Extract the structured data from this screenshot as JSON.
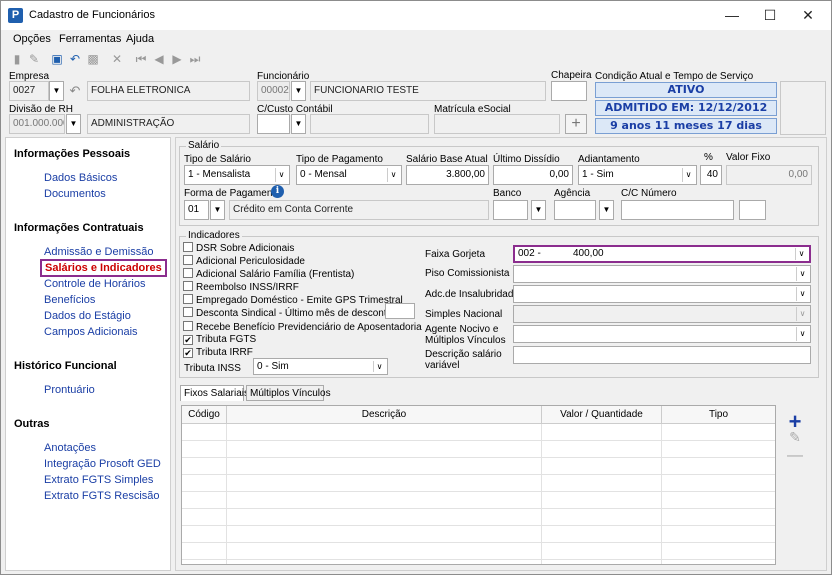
{
  "window": {
    "title": "Cadastro de Funcionários",
    "icon": "P"
  },
  "menu": [
    "Opções",
    "Ferramentas",
    "Ajuda"
  ],
  "header": {
    "empresa_label": "Empresa",
    "empresa_code": "0027",
    "empresa_name": "FOLHA ELETRONICA",
    "funcionario_label": "Funcionário",
    "funcionario_code": "00002",
    "funcionario_name": "FUNCIONARIO TESTE",
    "chapeira_label": "Chapeira",
    "chapeira_value": "",
    "divisao_label": "Divisão de RH",
    "divisao_code": "001.000.000",
    "divisao_name": "ADMINISTRAÇÃO",
    "custo_label": "C/Custo Contábil",
    "custo_value": "",
    "matricula_label": "Matrícula eSocial",
    "matricula_value": "",
    "condicao_label": "Condição Atual e Tempo de Serviço",
    "status": "ATIVO",
    "admitido": "ADMITIDO EM: 12/12/2012",
    "tempo": "9 anos 11 meses 17 dias"
  },
  "sidebar": {
    "sections": [
      {
        "title": "Informações Pessoais",
        "items": [
          "Dados Básicos",
          "Documentos"
        ]
      },
      {
        "title": "Informações Contratuais",
        "items": [
          "Admissão e Demissão",
          "Salários e Indicadores",
          "Controle de Horários",
          "Benefícios",
          "Dados do Estágio",
          "Campos Adicionais"
        ]
      },
      {
        "title": "Histórico Funcional",
        "items": [
          "Prontuário"
        ]
      },
      {
        "title": "Outras",
        "items": [
          "Anotações",
          "Integração Prosoft GED",
          "Extrato FGTS Simples",
          "Extrato FGTS Rescisão"
        ]
      }
    ],
    "active": "Salários e Indicadores"
  },
  "salario": {
    "group_title": "Salário",
    "tipo_salario_label": "Tipo de Salário",
    "tipo_salario": "1 - Mensalista",
    "tipo_pagamento_label": "Tipo de Pagamento",
    "tipo_pagamento": "0 - Mensal",
    "base_label": "Salário Base Atual",
    "base": "3.800,00",
    "ultimo_label": "Último Dissídio",
    "ultimo": "0,00",
    "adiantamento_label": "Adiantamento",
    "adiantamento": "1 - Sim",
    "pct_label": "%",
    "pct": "40",
    "fixo_label": "Valor Fixo",
    "fixo": "0,00",
    "forma_label": "Forma de Pagamento",
    "forma_code": "01",
    "forma_desc": "Crédito em Conta Corrente",
    "banco_label": "Banco",
    "banco": "",
    "agencia_label": "Agência",
    "agencia": "",
    "cc_label": "C/C Número",
    "cc": "",
    "cc_dv": ""
  },
  "indicadores": {
    "group_title": "Indicadores",
    "checks": [
      {
        "label": "DSR Sobre Adicionais",
        "checked": false
      },
      {
        "label": "Adicional Periculosidade",
        "checked": false
      },
      {
        "label": "Adicional Salário Família (Frentista)",
        "checked": false
      },
      {
        "label": "Reembolso INSS/IRRF",
        "checked": false
      },
      {
        "label": "Empregado Doméstico - Emite GPS Trimestral",
        "checked": false
      },
      {
        "label": "Desconta Sindical - Último mês de desconto",
        "checked": false
      },
      {
        "label": "Recebe Benefício Previdenciário de Aposentadoria",
        "checked": false
      },
      {
        "label": "Tributa FGTS",
        "checked": true
      },
      {
        "label": "Tributa IRRF",
        "checked": true
      }
    ],
    "tributa_inss_label": "Tributa INSS",
    "tributa_inss": "0 - Sim",
    "faixa_label": "Faixa Gorjeta",
    "faixa_code": "002 -",
    "faixa_value": "400,00",
    "piso_label": "Piso Comissionista",
    "insalubridade_label": "Adc.de Insalubridade",
    "simples_label": "Simples Nacional",
    "agente_label_1": "Agente Nocivo e",
    "agente_label_2": "Múltiplos Vínculos",
    "descricao_label_1": "Descrição salário",
    "descricao_label_2": "variável"
  },
  "tabs": [
    "Fixos Salariais",
    "Múltiplos Vínculos"
  ],
  "grid": {
    "columns": [
      "Código",
      "Descrição",
      "Valor / Quantidade",
      "Tipo"
    ]
  },
  "icons": {
    "accent": "#1a3ea5",
    "highlight": "#8b2d8e"
  }
}
